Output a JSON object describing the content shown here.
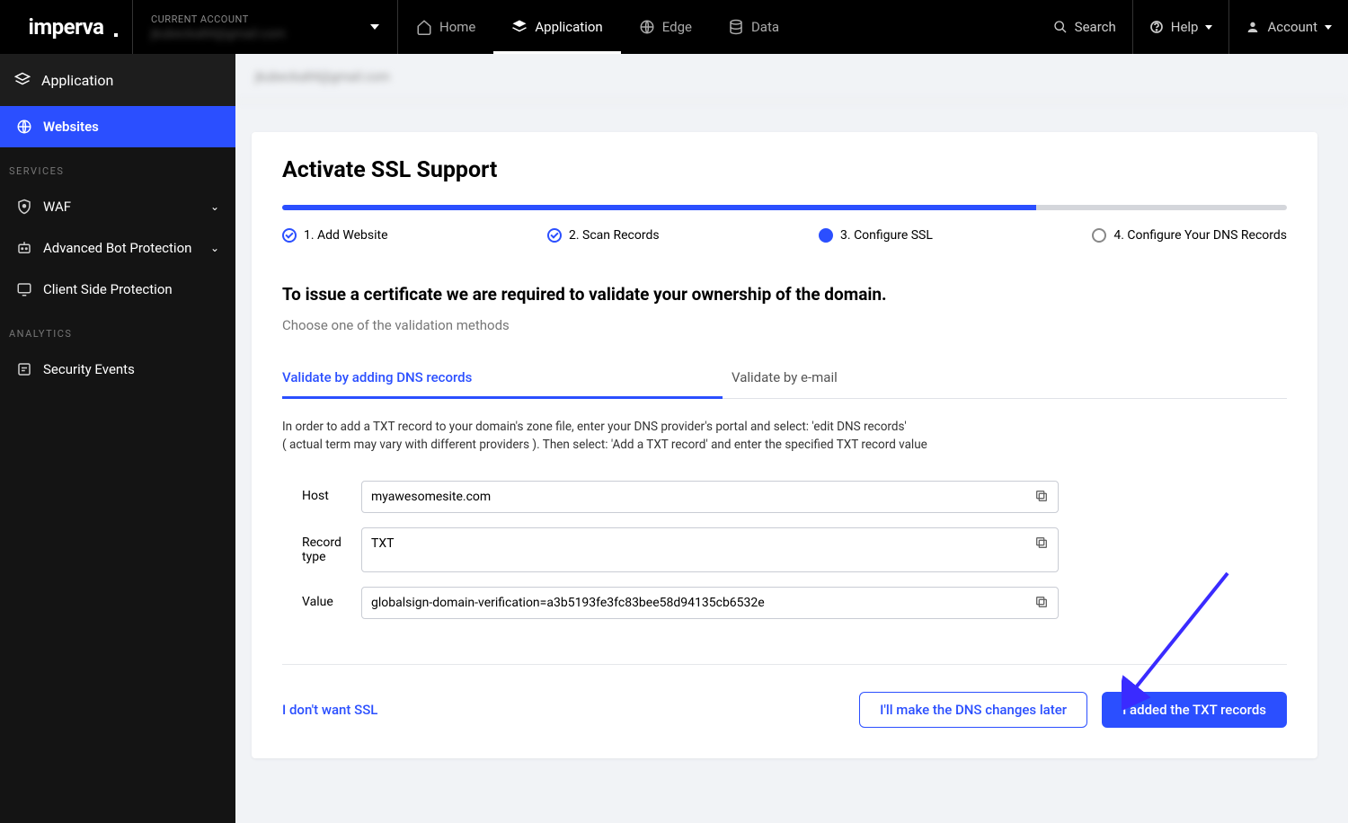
{
  "brand": "imperva",
  "account": {
    "label": "CURRENT ACCOUNT",
    "value": "jkubecka84@gmail.com"
  },
  "nav": {
    "home": "Home",
    "application": "Application",
    "edge": "Edge",
    "data": "Data"
  },
  "top_right": {
    "search": "Search",
    "help": "Help",
    "account": "Account"
  },
  "sidebar": {
    "header": "Application",
    "websites": "Websites",
    "services_label": "SERVICES",
    "waf": "WAF",
    "abp": "Advanced Bot Protection",
    "csp": "Client Side Protection",
    "analytics_label": "ANALYTICS",
    "events": "Security Events"
  },
  "breadcrumb": "jkubecka84@gmail.com",
  "title": "Activate SSL Support",
  "steps": {
    "s1": "1. Add Website",
    "s2": "2. Scan Records",
    "s3": "3. Configure SSL",
    "s4": "4. Configure Your DNS Records"
  },
  "lead": "To issue a certificate we are required to validate your ownership of the domain.",
  "sub": "Choose one of the validation methods",
  "tabs": {
    "dns": "Validate by adding DNS records",
    "email": "Validate by e-mail"
  },
  "instructions_l1": "In order to add a TXT record to your domain's zone file, enter your DNS provider's portal and select: 'edit DNS records'",
  "instructions_l2": "( actual term may vary with different providers ). Then select: 'Add a TXT record' and enter the specified TXT record value",
  "fields": {
    "host_label": "Host",
    "host_value": "myawesomesite.com",
    "type_label": "Record type",
    "type_value": "TXT",
    "value_label": "Value",
    "value_value": "globalsign-domain-verification=a3b5193fe3fc83bee58d94135cb6532e"
  },
  "footer": {
    "no_ssl": "I don't want SSL",
    "later": "I'll make the DNS changes later",
    "added": "I added the TXT records"
  }
}
